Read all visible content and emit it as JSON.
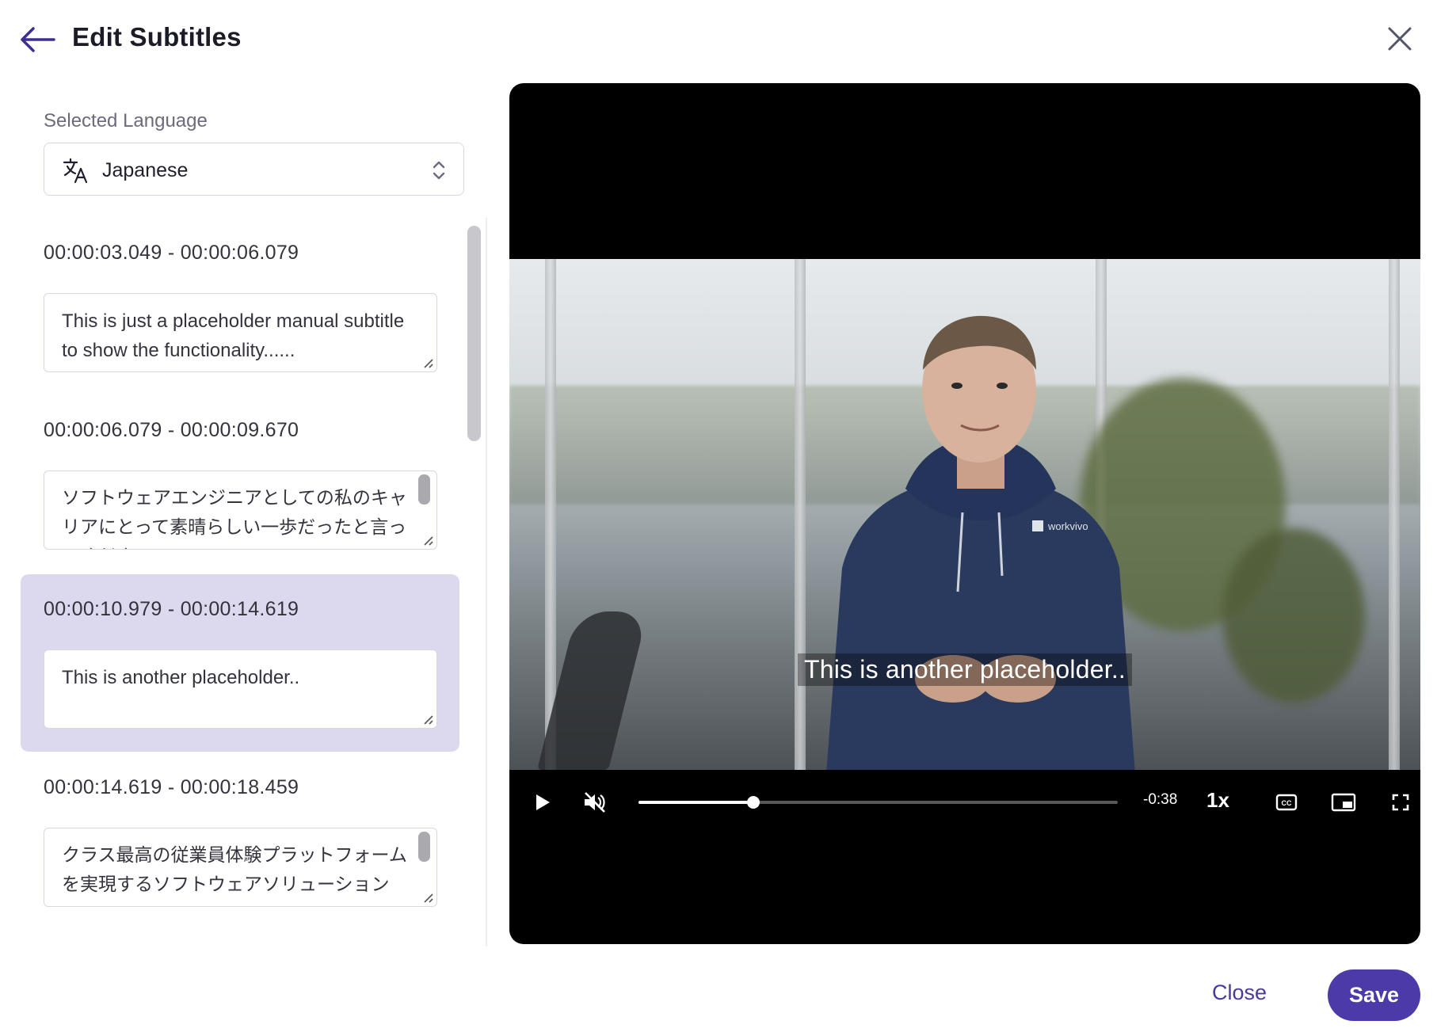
{
  "header": {
    "title": "Edit Subtitles",
    "back_icon": "arrow-left-icon",
    "close_icon": "close-icon"
  },
  "language": {
    "label": "Selected Language",
    "value": "Japanese",
    "icon": "translate-icon",
    "chevron_icon": "updown-chevron-icon"
  },
  "cues": [
    {
      "time": "00:00:03.049 - 00:00:06.079",
      "text": "This is just a placeholder manual subtitle to show the functionality......",
      "active": false
    },
    {
      "time": "00:00:06.079 - 00:00:09.670",
      "text": "ソフトウェアエンジニアとしての私のキャリアにとって素晴らしい一歩だったと言ってください",
      "active": false
    },
    {
      "time": "00:00:10.979 - 00:00:14.619",
      "text": "This is another placeholder..",
      "active": true
    },
    {
      "time": "00:00:14.619 - 00:00:18.459",
      "text": "クラス最高の従業員体験プラットフォームを実現するソフトウェアソリューション",
      "active": false
    }
  ],
  "video": {
    "caption": "This is another placeholder..",
    "time_remaining": "-0:38",
    "speed": "1x",
    "progress": 0.24,
    "muted": true,
    "brand_on_hoodie": "workvivo",
    "controls": [
      "play-icon",
      "muted-volume-icon",
      "cc-icon",
      "picture-in-picture-icon",
      "fullscreen-icon"
    ]
  },
  "footer": {
    "close_label": "Close",
    "save_label": "Save"
  },
  "colors": {
    "accent": "#4b3aa8",
    "active_row": "#dcd8ee",
    "title": "#1c1c28"
  }
}
